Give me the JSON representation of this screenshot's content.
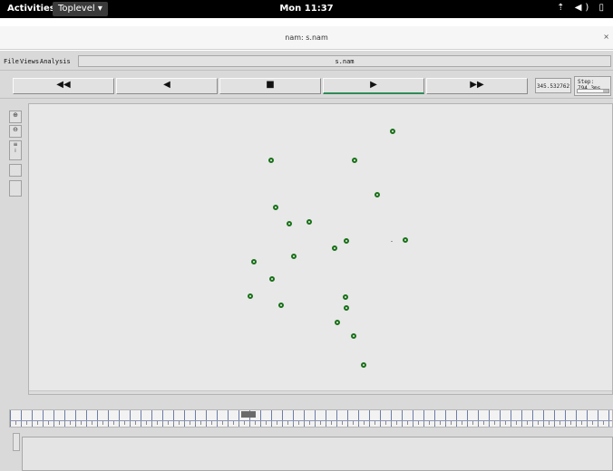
{
  "topbar": {
    "activities": "Activities",
    "app_menu": "Toplevel ▾",
    "clock": "Mon 11:37",
    "tray": "⇡ ◀) ▯"
  },
  "window": {
    "title": "nam: s.nam",
    "close": "×"
  },
  "menubar": {
    "file": "File",
    "views": "Views",
    "analysis": "Analysis",
    "filename": "s.nam"
  },
  "transport": {
    "rewind": "◀◀",
    "back": "◀",
    "stop": "■",
    "play": "▶",
    "fastforward": "▶▶",
    "time": "345.532762",
    "step": "Step: 794.3ms"
  },
  "timeline": {
    "marker_label": "▮▮▮"
  },
  "nodes_count_label": "",
  "colors": {
    "node_stroke": "#187018",
    "play_underline": "#2e8b57"
  }
}
